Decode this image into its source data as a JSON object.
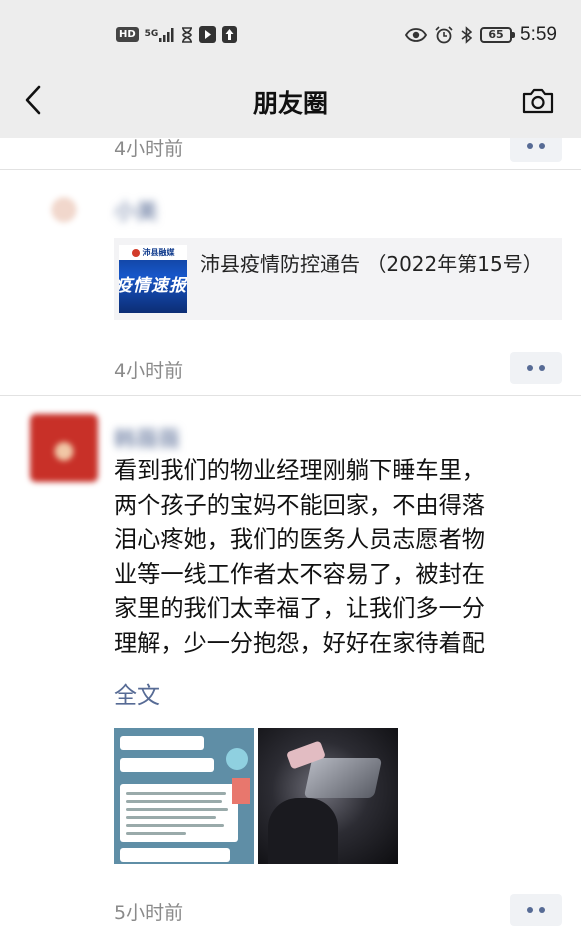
{
  "status_bar": {
    "hd": "HD",
    "network": "5G",
    "time": "5:59",
    "battery": "65"
  },
  "header": {
    "title": "朋友圈"
  },
  "feed": {
    "prev_post": {
      "time": "4小时前"
    },
    "posts": [
      {
        "nickname": "小美",
        "share": {
          "thumb_badge": "沛县融媒",
          "thumb_text": "疫情速报",
          "title": "沛县疫情防控通告 （2022年第15号）"
        },
        "time": "4小时前"
      },
      {
        "nickname": "韩薇薇",
        "text": "看到我们的物业经理刚躺下睡车里，\n两个孩子的宝妈不能回家，不由得落\n泪心疼她，我们的医务人员志愿者物\n业等一线工作者太不容易了，被封在\n家里的我们太幸福了，让我们多一分\n理解，少一分抱怨，好好在家待着配",
        "full_text_link": "全文",
        "time": "5小时前"
      }
    ]
  },
  "colors": {
    "link": "#576b95",
    "header_bg": "#ededed",
    "time_gray": "#8a8a8a"
  }
}
